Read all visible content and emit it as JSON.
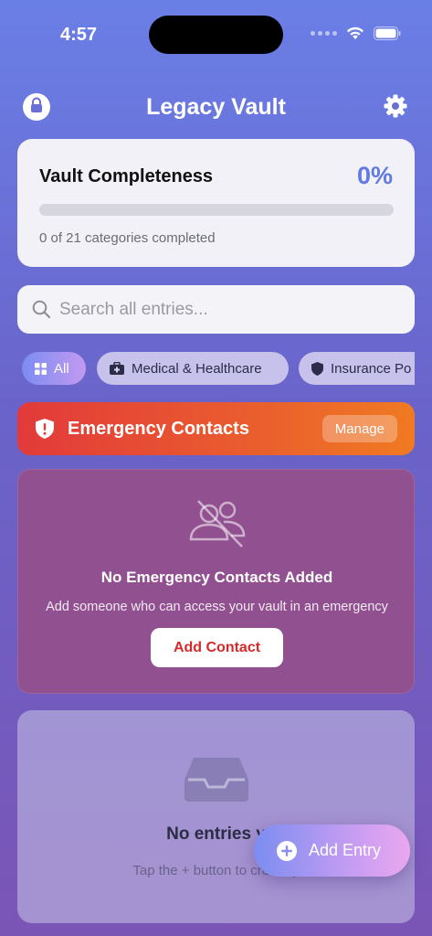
{
  "status_bar": {
    "time": "4:57"
  },
  "header": {
    "title": "Legacy Vault",
    "lock_icon": "lock-icon",
    "settings_icon": "gear-icon"
  },
  "completeness": {
    "title": "Vault Completeness",
    "percent_label": "0%",
    "progress": 0,
    "subtitle": "0 of 21 categories completed",
    "accent": "#6079e3"
  },
  "search": {
    "placeholder": "Search all entries..."
  },
  "chips": [
    {
      "label": "All",
      "icon": "grid-icon",
      "active": true
    },
    {
      "label": "Medical & Healthcare",
      "icon": "medical-kit-icon",
      "active": false
    },
    {
      "label": "Insurance Po",
      "icon": "shield-icon",
      "active": false
    }
  ],
  "emergency": {
    "title": "Emergency Contacts",
    "manage_label": "Manage",
    "empty_title": "No Emergency Contacts Added",
    "empty_subtitle": "Add someone who can access your vault in an emergency",
    "add_label": "Add Contact",
    "accent": "#e23a3a"
  },
  "entries": {
    "empty_title": "No entries y",
    "empty_subtitle": "Tap the + button to create y"
  },
  "fab": {
    "label": "Add Entry"
  }
}
